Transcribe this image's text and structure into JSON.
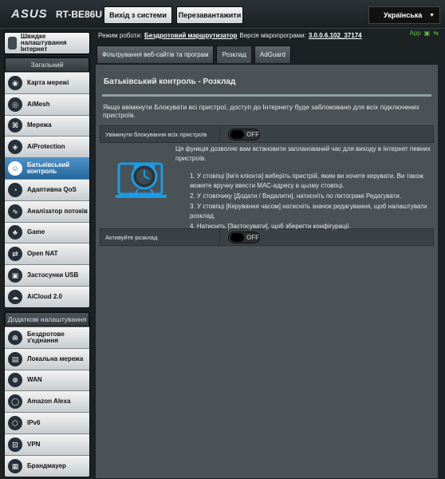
{
  "header": {
    "logo": "ASUS",
    "model": "RT-BE86U",
    "logout_label": "Вихід з системи",
    "reboot_label": "Перезавантажити",
    "language": "Українська"
  },
  "info": {
    "mode_label": "Режим роботи:",
    "mode_value": "Бездротовий маршрутизатор",
    "fw_label": "Версія мікропрограми:",
    "fw_value": "3.0.0.6.102_37174",
    "app_label": "App"
  },
  "sidebar": {
    "quick_setup": "Швидке налаштування Інтернет",
    "general_title": "Загальний",
    "general_items": [
      {
        "label": "Карта мережі",
        "icon": "network-map-icon"
      },
      {
        "label": "AiMesh",
        "icon": "aimesh-icon"
      },
      {
        "label": "Мережа",
        "icon": "network-icon"
      },
      {
        "label": "AiProtection",
        "icon": "shield-icon"
      },
      {
        "label": "Батьківський контроль",
        "icon": "parental-icon"
      },
      {
        "label": "Адаптивна QoS",
        "icon": "qos-icon"
      },
      {
        "label": "Аналізатор потоків",
        "icon": "traffic-icon"
      },
      {
        "label": "Game",
        "icon": "game-icon"
      },
      {
        "label": "Open NAT",
        "icon": "nat-icon"
      },
      {
        "label": "Застосунки USB",
        "icon": "usb-icon"
      },
      {
        "label": "AiCloud 2.0",
        "icon": "cloud-icon"
      }
    ],
    "advanced_title": "Додаткові налаштування",
    "advanced_items": [
      {
        "label": "Бездротове з'єднання",
        "icon": "wireless-icon"
      },
      {
        "label": "Локальна мережа",
        "icon": "lan-icon"
      },
      {
        "label": "WAN",
        "icon": "wan-icon"
      },
      {
        "label": "Amazon Alexa",
        "icon": "alexa-icon"
      },
      {
        "label": "IPv6",
        "icon": "ipv6-icon"
      },
      {
        "label": "VPN",
        "icon": "vpn-icon"
      },
      {
        "label": "Брандмауер",
        "icon": "firewall-icon"
      }
    ]
  },
  "tabs": [
    "Фільтрування веб-сайтів та програм",
    "Розклад",
    "AdGuard"
  ],
  "panel": {
    "title": "Батьківський контроль - Розклад",
    "note": "Якщо ввімкнути Блокувати всі пристрої, доступ до Інтернету буде заблоковано для всіх підключених пристроїв.",
    "block_all_label": "Увімкнути блокування всіх пристроїв",
    "toggle_off": "OFF",
    "desc_intro": "Ця функція дозволяє вам встановити запланований час для виходу в Інтернет певних пристроїв.",
    "steps": [
      "1. У стовпці [Ім'я клієнта] виберіть пристрій, яким ви хочете керувати. Ви також можете вручну ввести МАС-адресу в цьому стовпці.",
      "2. У стовпчику [Додати / Видалити], натисніть по піктограмі Редагувати.",
      "3. У стовпці [Керування часом] натисніть значок редагування, щоб налаштувати розклад.",
      "4. Натисніть [Застосувати], щоб зберегти конфігурації."
    ],
    "activate_label": "Активуйте розклад"
  }
}
